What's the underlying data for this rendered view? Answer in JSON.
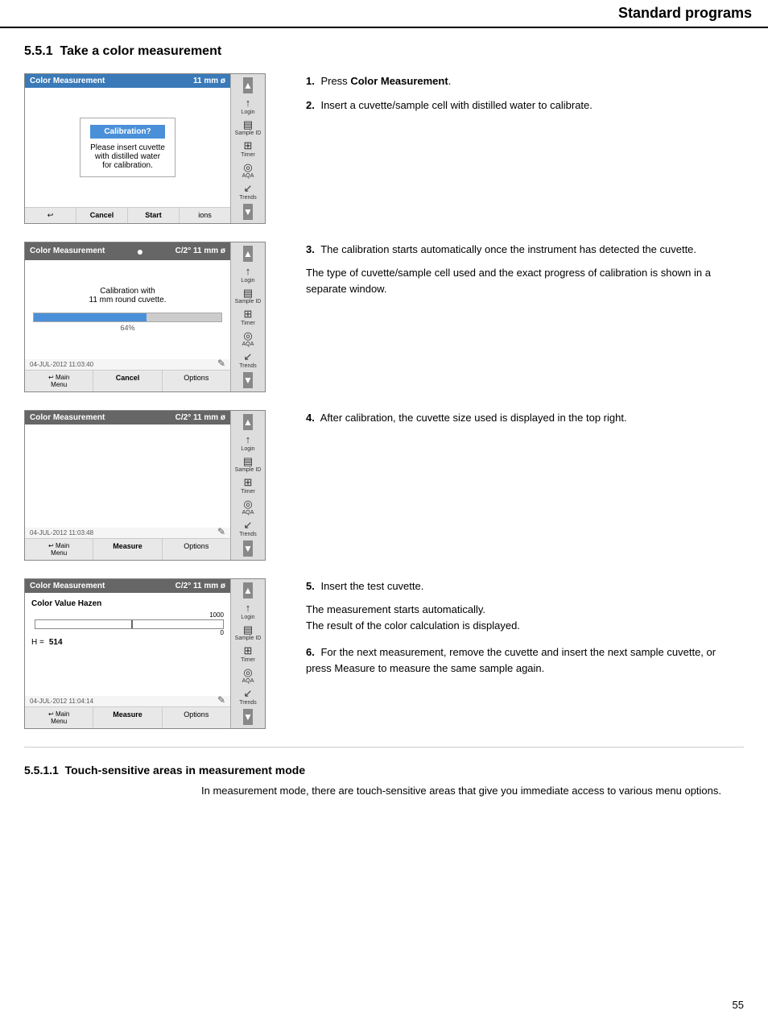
{
  "header": {
    "title": "Standard programs"
  },
  "section": {
    "number": "5.5.1",
    "title": "Take a color measurement"
  },
  "subsection": {
    "number": "5.5.1.1",
    "title": "Touch-sensitive areas in measurement mode",
    "text": "In measurement mode, there are touch-sensitive areas that give you immediate access to various menu options."
  },
  "page_number": "55",
  "steps": [
    {
      "num": "1.",
      "text": "Press ",
      "bold": "Color Measurement",
      "text2": "."
    },
    {
      "num": "2.",
      "text": "Insert a cuvette/sample cell with distilled water to calibrate."
    },
    {
      "num": "3.",
      "text": "The calibration starts automatically once the instrument has detected the cuvette."
    },
    {
      "num": "3b",
      "text": "The type of cuvette/sample cell used and the exact progress of calibration is shown in a separate window."
    },
    {
      "num": "4.",
      "text": "After calibration, the cuvette size used is displayed in the top right."
    },
    {
      "num": "5.",
      "text": "Insert the test cuvette."
    },
    {
      "num": "5b",
      "text": "The measurement starts automatically.\nThe result of the color calculation is displayed."
    },
    {
      "num": "6.",
      "text": "For the next measurement, remove the cuvette and insert the next sample cuvette, or press Measure to measure the same sample again."
    }
  ],
  "screens": [
    {
      "id": "screen1",
      "titlebar": "Color Measurement",
      "titlebar_right": "11 mm ø",
      "dialog_title": "Calibration?",
      "dialog_body": "Please insert cuvette\nwith distilled water\nfor calibration.",
      "timestamp": "",
      "footer": [
        "↩",
        "Cancel",
        "Start",
        "ions"
      ],
      "footer_bold": [
        1,
        2
      ]
    },
    {
      "id": "screen2",
      "titlebar": "Color Measurement",
      "titlebar_right": "C/2°  11 mm ø",
      "body_title": "Calibration with\n11 mm round cuvette.",
      "timestamp": "04-JUL-2012  11:03:40",
      "footer": [
        "↩ Main Menu",
        "Cancel",
        "Options"
      ],
      "footer_bold": [
        1
      ]
    },
    {
      "id": "screen3",
      "titlebar": "Color Measurement",
      "titlebar_right": "C/2°  11 mm ø",
      "timestamp": "04-JUL-2012  11:03:48",
      "footer": [
        "↩ Main Menu",
        "Measure",
        "Options"
      ],
      "footer_bold": [
        1
      ]
    },
    {
      "id": "screen4",
      "titlebar": "Color Measurement",
      "titlebar_right": "C/2°  11 mm ø",
      "hazen_title": "Color Value Hazen",
      "hazen_value": "H =    514",
      "timestamp": "04-JUL-2012  11:04:14",
      "footer": [
        "↩ Main Menu",
        "Measure",
        "Options"
      ],
      "footer_bold": [
        1
      ]
    }
  ],
  "sidebar_icons": [
    {
      "sym": "↑",
      "label": "Login"
    },
    {
      "sym": "▤",
      "label": "Sample ID"
    },
    {
      "sym": "⊞",
      "label": "Timer"
    },
    {
      "sym": "◎",
      "label": "AQA"
    },
    {
      "sym": "↙",
      "label": "Trends"
    }
  ]
}
